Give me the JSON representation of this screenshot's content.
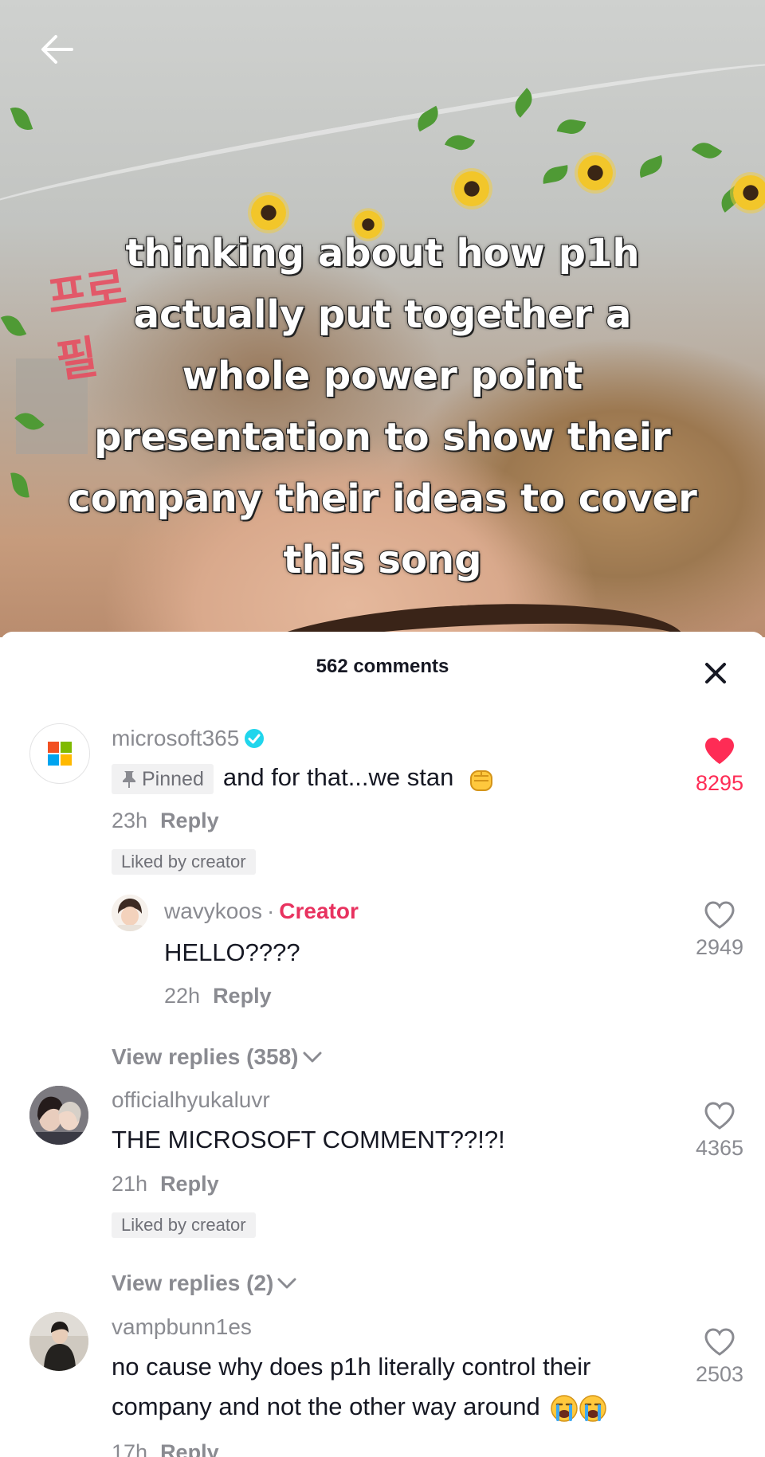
{
  "video": {
    "caption": "thinking about how p1h actually put together a whole power point presentation to show their company their ideas to cover this song",
    "sign_text": "프로필"
  },
  "sheet": {
    "title": "562 comments"
  },
  "comments": [
    {
      "username": "microsoft365",
      "verified": true,
      "pinned_label": "Pinned",
      "text": "and for that...we stan",
      "emoji": "fist-emoji",
      "time": "23h",
      "reply_label": "Reply",
      "liked_badge": "Liked by creator",
      "likes": "8295",
      "liked": true,
      "reply": {
        "username": "wavykoos",
        "tag": "Creator",
        "text": "HELLO????",
        "time": "22h",
        "reply_label": "Reply",
        "likes": "2949"
      },
      "view_replies": "View replies (358)"
    },
    {
      "username": "officialhyukaluvr",
      "text": "THE MICROSOFT COMMENT??!?!",
      "time": "21h",
      "reply_label": "Reply",
      "liked_badge": "Liked by creator",
      "likes": "4365",
      "liked": false,
      "view_replies": "View replies (2)"
    },
    {
      "username": "vampbunn1es",
      "text": "no cause why does p1h literally control their company and not the other way around",
      "emoji": "crying-emoji",
      "time": "17h",
      "reply_label": "Reply",
      "likes": "2503",
      "liked": false
    }
  ],
  "colors": {
    "accent": "#fe2c55",
    "creator": "#e8325f",
    "verified": "#20d5ec",
    "text_primary": "#161823",
    "text_secondary": "#8a8b91"
  }
}
